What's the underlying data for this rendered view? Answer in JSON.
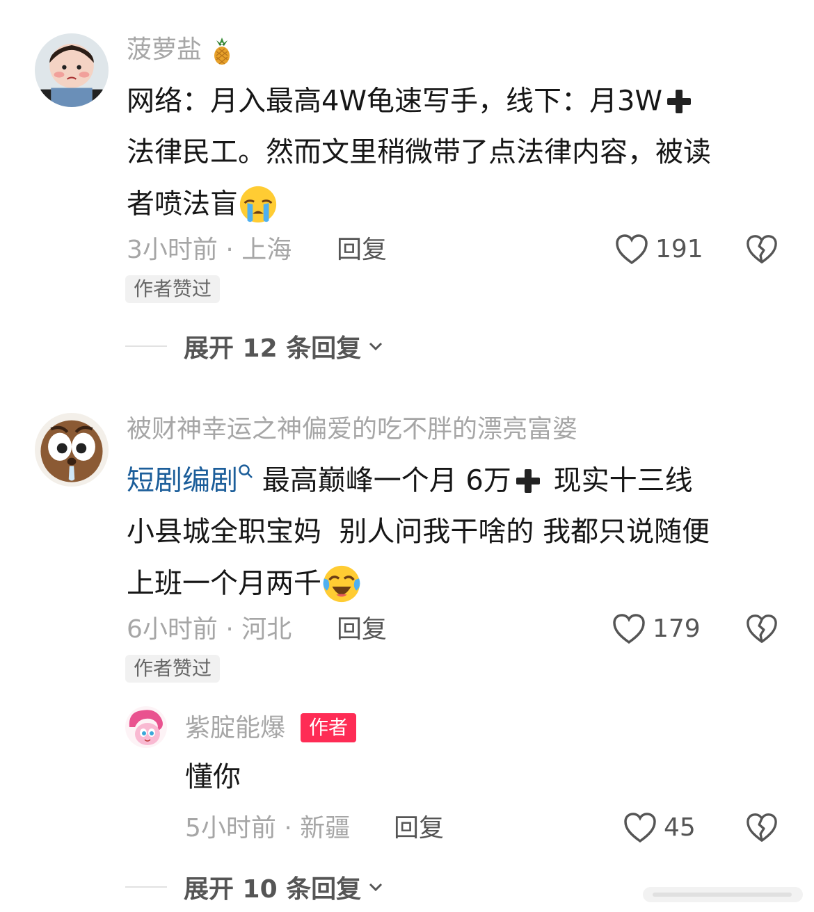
{
  "comments": [
    {
      "username": "菠萝盐",
      "username_emoji": "pineapple-icon",
      "line1": "网络：月入最高4W龟速写手，线下：月3W",
      "line2": "法律民工。然而文里稍微带了点法律内容，被读",
      "line3": "者喷法盲",
      "time_location": "3小时前 · 上海",
      "reply_label": "回复",
      "likes": "191",
      "liked_badge": "作者赞过",
      "expand_label": "展开 12 条回复"
    },
    {
      "username": "被财神幸运之神偏爱的吃不胖的漂亮富婆",
      "link_text": "短剧编剧",
      "line1_rest": "最高巅峰一个月 6万",
      "line1_end": "现实十三线",
      "line2": "小县城全职宝妈  别人问我干啥的 我都只说随便",
      "line3": "上班一个月两千",
      "time_location": "6小时前 · 河北",
      "reply_label": "回复",
      "likes": "179",
      "liked_badge": "作者赞过"
    }
  ],
  "reply": {
    "username": "紫腚能爆",
    "author_tag": "作者",
    "text": "懂你",
    "time_location": "5小时前 · 新疆",
    "reply_label": "回复",
    "likes": "45"
  },
  "expand2_label": "展开 10 条回复",
  "colors": {
    "accent": "#fe2c55",
    "link": "#1c5e9a",
    "muted": "#a6a6a6"
  }
}
